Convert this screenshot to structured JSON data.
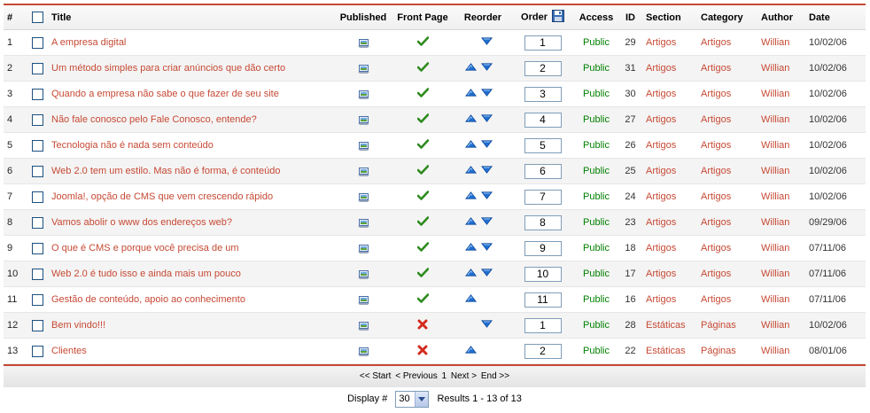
{
  "header": {
    "num": "#",
    "title": "Title",
    "published": "Published",
    "front_page": "Front Page",
    "reorder": "Reorder",
    "order": "Order",
    "access": "Access",
    "id": "ID",
    "section": "Section",
    "category": "Category",
    "author": "Author",
    "date": "Date"
  },
  "rows": [
    {
      "num": "1",
      "title": "A empresa digital",
      "front": "check",
      "up": false,
      "down": true,
      "order": "1",
      "access": "Public",
      "id": "29",
      "section": "Artigos",
      "category": "Artigos",
      "author": "Willian",
      "date": "10/02/06"
    },
    {
      "num": "2",
      "title": "Um método simples para criar anúncios que dão certo",
      "front": "check",
      "up": true,
      "down": true,
      "order": "2",
      "access": "Public",
      "id": "31",
      "section": "Artigos",
      "category": "Artigos",
      "author": "Willian",
      "date": "10/02/06"
    },
    {
      "num": "3",
      "title": "Quando a empresa não sabe o que fazer de seu site",
      "front": "check",
      "up": true,
      "down": true,
      "order": "3",
      "access": "Public",
      "id": "30",
      "section": "Artigos",
      "category": "Artigos",
      "author": "Willian",
      "date": "10/02/06"
    },
    {
      "num": "4",
      "title": "Não fale conosco pelo Fale Conosco, entende?",
      "front": "check",
      "up": true,
      "down": true,
      "order": "4",
      "access": "Public",
      "id": "27",
      "section": "Artigos",
      "category": "Artigos",
      "author": "Willian",
      "date": "10/02/06"
    },
    {
      "num": "5",
      "title": "Tecnologia não é nada sem conteúdo",
      "front": "check",
      "up": true,
      "down": true,
      "order": "5",
      "access": "Public",
      "id": "26",
      "section": "Artigos",
      "category": "Artigos",
      "author": "Willian",
      "date": "10/02/06"
    },
    {
      "num": "6",
      "title": "Web 2.0 tem um estilo. Mas não é forma, é conteúdo",
      "front": "check",
      "up": true,
      "down": true,
      "order": "6",
      "access": "Public",
      "id": "25",
      "section": "Artigos",
      "category": "Artigos",
      "author": "Willian",
      "date": "10/02/06"
    },
    {
      "num": "7",
      "title": "Joomla!, opção de CMS que vem crescendo rápido",
      "front": "check",
      "up": true,
      "down": true,
      "order": "7",
      "access": "Public",
      "id": "24",
      "section": "Artigos",
      "category": "Artigos",
      "author": "Willian",
      "date": "10/02/06"
    },
    {
      "num": "8",
      "title": "Vamos abolir o www dos endereços web?",
      "front": "check",
      "up": true,
      "down": true,
      "order": "8",
      "access": "Public",
      "id": "23",
      "section": "Artigos",
      "category": "Artigos",
      "author": "Willian",
      "date": "09/29/06"
    },
    {
      "num": "9",
      "title": "O que é CMS e porque você precisa de um",
      "front": "check",
      "up": true,
      "down": true,
      "order": "9",
      "access": "Public",
      "id": "18",
      "section": "Artigos",
      "category": "Artigos",
      "author": "Willian",
      "date": "07/11/06"
    },
    {
      "num": "10",
      "title": "Web 2.0 é tudo isso e ainda mais um pouco",
      "front": "check",
      "up": true,
      "down": true,
      "order": "10",
      "access": "Public",
      "id": "17",
      "section": "Artigos",
      "category": "Artigos",
      "author": "Willian",
      "date": "07/11/06"
    },
    {
      "num": "11",
      "title": "Gestão de conteúdo, apoio ao conhecimento",
      "front": "check",
      "up": true,
      "down": false,
      "order": "11",
      "access": "Public",
      "id": "16",
      "section": "Artigos",
      "category": "Artigos",
      "author": "Willian",
      "date": "07/11/06"
    },
    {
      "num": "12",
      "title": "Bem vindo!!!",
      "front": "cross",
      "up": false,
      "down": true,
      "order": "1",
      "access": "Public",
      "id": "28",
      "section": "Estáticas",
      "category": "Páginas",
      "author": "Willian",
      "date": "10/02/06"
    },
    {
      "num": "13",
      "title": "Clientes",
      "front": "cross",
      "up": true,
      "down": false,
      "order": "2",
      "access": "Public",
      "id": "22",
      "section": "Estáticas",
      "category": "Páginas",
      "author": "Willian",
      "date": "08/01/06"
    }
  ],
  "pagination": {
    "start": "<< Start",
    "previous": "< Previous",
    "page": "1",
    "next": "Next >",
    "end": "End >>"
  },
  "display": {
    "label": "Display #",
    "selected": "30",
    "results": "Results 1 - 13 of 13"
  },
  "colors": {
    "link": "#c64934",
    "access": "#008000",
    "check": "#2e8b1e",
    "cross": "#d42b1e",
    "arrow": "#1f6fd1"
  },
  "icons": {
    "published": "published-icon",
    "check": "check-icon",
    "cross": "cross-icon",
    "up": "arrow-up-icon",
    "down": "arrow-down-icon",
    "save": "save-order-icon"
  }
}
